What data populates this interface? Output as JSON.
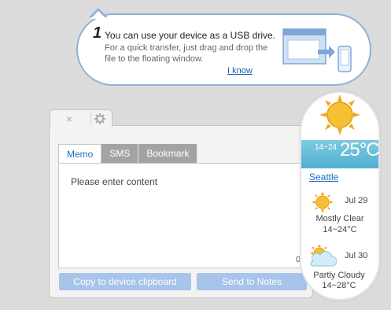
{
  "tooltip": {
    "step": "1",
    "title": "You can use your device as a USB drive.",
    "body": "For a quick transfer, just drag and drop the file to the floating window.",
    "link": "I know"
  },
  "window": {
    "close_icon": "×",
    "gear_icon": "gear",
    "tabs": [
      {
        "label": "Memo",
        "active": true
      },
      {
        "label": "SMS",
        "active": false
      },
      {
        "label": "Bookmark",
        "active": false
      }
    ],
    "editor": {
      "placeholder": "Please enter content",
      "char_count": "0"
    },
    "buttons": {
      "clipboard": "Copy to device clipboard",
      "notes": "Send to Notes"
    }
  },
  "weather": {
    "temp_range": "14~24",
    "temp_now": "25°C",
    "city": "Seattle",
    "days": [
      {
        "date": "Jul 29",
        "desc": "Mostly Clear",
        "range": "14~24°C",
        "icon": "sun-icon"
      },
      {
        "date": "Jul 30",
        "desc": "Partly Cloudy",
        "range": "14~28°C",
        "icon": "partly-cloudy-icon"
      }
    ],
    "colors": {
      "band": "#4fb0d0",
      "sun": "#f2b320",
      "accent": "#1a6ec1"
    }
  }
}
